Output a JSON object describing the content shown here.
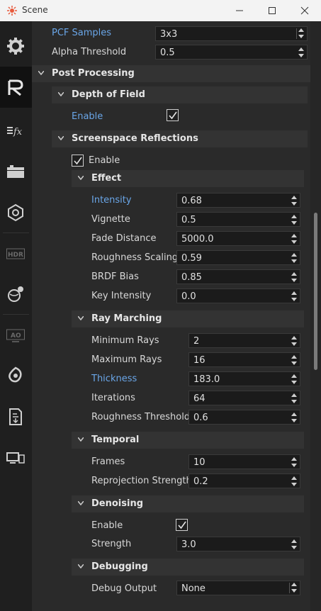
{
  "window": {
    "title": "Scene"
  },
  "sidebar": {
    "icons": [
      "gear-icon",
      "renderer-icon",
      "fx-icon",
      "layers-icon",
      "camera-settings-icon",
      "hdr-icon",
      "globe-light-icon",
      "ao-icon",
      "effects-icon",
      "export-icon",
      "devices-icon"
    ]
  },
  "top": {
    "pcf_label": "PCF Samples",
    "pcf_value": "3x3",
    "alpha_label": "Alpha Threshold",
    "alpha_value": "0.5"
  },
  "post": {
    "title": "Post Processing"
  },
  "dof": {
    "title": "Depth of Field",
    "enable_label": "Enable"
  },
  "ssr": {
    "title": "Screenspace Reflections",
    "enable_label": "Enable",
    "effect": {
      "title": "Effect",
      "rows": [
        {
          "label": "Intensity",
          "value": "0.68"
        },
        {
          "label": "Vignette",
          "value": "0.5"
        },
        {
          "label": "Fade Distance",
          "value": "5000.0"
        },
        {
          "label": "Roughness Scaling",
          "value": "0.59"
        },
        {
          "label": "BRDF Bias",
          "value": "0.85"
        },
        {
          "label": "Key Intensity",
          "value": "0.0"
        }
      ]
    },
    "ray": {
      "title": "Ray Marching",
      "rows": [
        {
          "label": "Minimum Rays",
          "value": "2"
        },
        {
          "label": "Maximum Rays",
          "value": "16"
        },
        {
          "label": "Thickness",
          "value": "183.0"
        },
        {
          "label": "Iterations",
          "value": "64"
        },
        {
          "label": "Roughness Threshold",
          "value": "0.6"
        }
      ]
    },
    "temporal": {
      "title": "Temporal",
      "rows": [
        {
          "label": "Frames",
          "value": "10"
        },
        {
          "label": "Reprojection Strength",
          "value": "0.2"
        }
      ]
    },
    "denoising": {
      "title": "Denoising",
      "enable_label": "Enable",
      "strength_label": "Strength",
      "strength_value": "3.0"
    },
    "debugging": {
      "title": "Debugging",
      "debug_label": "Debug Output",
      "debug_value": "None"
    }
  },
  "colors": {
    "accent": "#6aa6e8",
    "bg": "#2a2a2a",
    "header": "#333333",
    "field": "#1b1b1b"
  }
}
